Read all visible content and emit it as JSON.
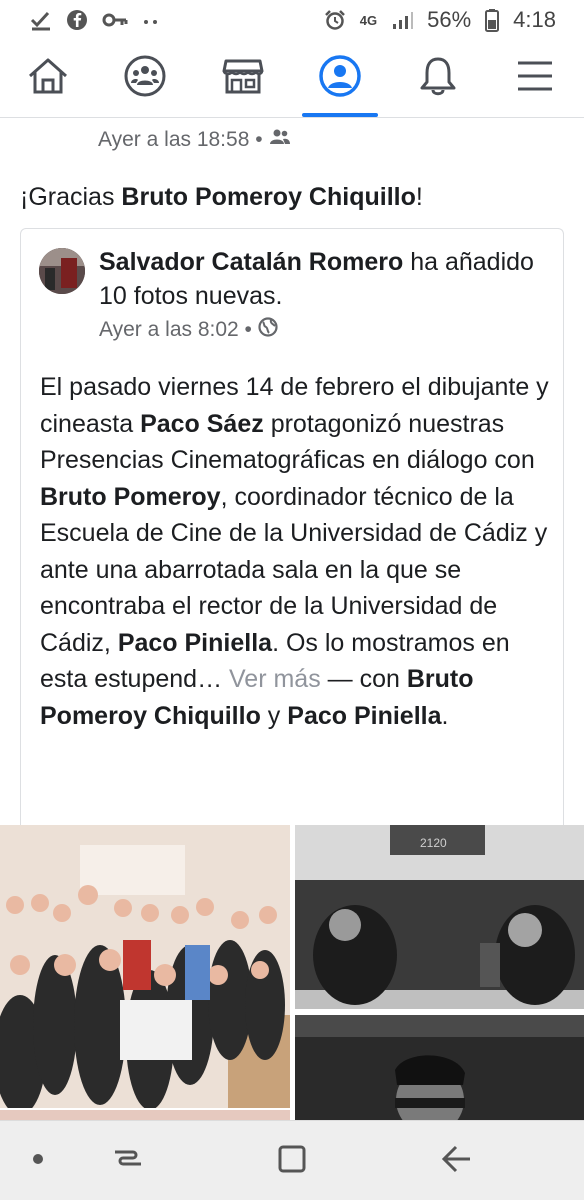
{
  "status_bar": {
    "network": "4G",
    "battery": "56%",
    "time": "4:18",
    "left_icons": [
      "check-download-icon",
      "facebook-icon",
      "key-icon",
      "more-dots-icon"
    ],
    "right_icons": [
      "alarm-icon",
      "signal-icon",
      "battery-icon"
    ]
  },
  "nav": {
    "items": [
      {
        "name": "home-icon",
        "active": false
      },
      {
        "name": "groups-icon",
        "active": false
      },
      {
        "name": "marketplace-icon",
        "active": false
      },
      {
        "name": "profile-icon",
        "active": true
      },
      {
        "name": "notifications-icon",
        "active": false
      },
      {
        "name": "menu-icon",
        "active": false
      }
    ],
    "accent": "#1877f2"
  },
  "post": {
    "meta": "Ayer a las 18:58 •",
    "audience_icon": "friends-icon",
    "thanks_prefix": "¡Gracias ",
    "thanks_name": "Bruto Pomeroy Chiquillo",
    "thanks_suffix": "!"
  },
  "shared": {
    "author": "Salvador Catalán Romero",
    "action": " ha añadido 10 fotos nuevas.",
    "meta": "Ayer a las 8:02 •",
    "audience_icon": "globe-icon",
    "body": {
      "p1": "El pasado viernes 14 de febrero el dibujante y cineasta ",
      "b1": "Paco Sáez",
      "p2": " protagonizó nuestras Presencias Cinematográficas en diálogo con ",
      "b2": "Bruto Pomeroy",
      "p3": ", coordinador técnico de la Escuela de Cine de la Universidad de Cádiz y ante una abarrotada sala en la que se encontraba el rector de la Universidad de Cádiz, ",
      "b3": "Paco Piniella",
      "p4": ". Os lo mostramos en esta estupend… ",
      "see_more": "Ver más",
      "with": " — con ",
      "b4": "Bruto Pomeroy Chiquillo",
      "and": " y ",
      "b5": "Paco Piniella",
      "end": "."
    }
  },
  "photos": {
    "main_text": "2120",
    "count": 10
  },
  "bottom_nav": [
    "dot-icon",
    "recent-apps-icon",
    "home-square-icon",
    "back-icon"
  ]
}
